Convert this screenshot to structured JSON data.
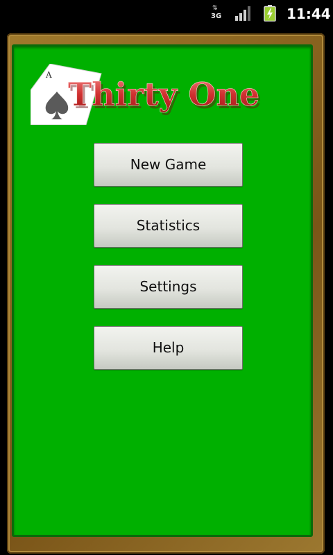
{
  "status_bar": {
    "network": "3G",
    "time": "11:44"
  },
  "logo": {
    "title": "Thirty One",
    "card_rank": "A"
  },
  "menu": {
    "new_game": "New Game",
    "statistics": "Statistics",
    "settings": "Settings",
    "help": "Help"
  },
  "colors": {
    "felt": "#00b000",
    "frame": "#8a6420",
    "title": "#d03030"
  }
}
